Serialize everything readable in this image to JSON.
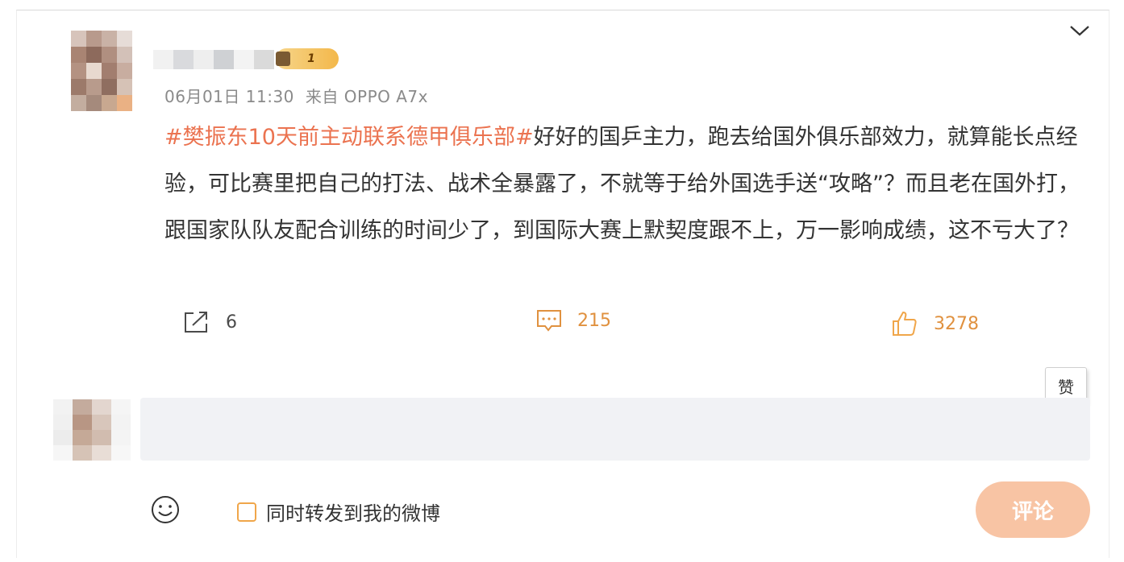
{
  "comment": {
    "badge_level": "1",
    "time": "06月01日 11:30",
    "source": "来自 OPPO A7x",
    "hashtag": "#樊振东10天前主动联系德甲俱乐部#",
    "text": "好好的国乒主力，跑去给国外俱乐部效力，就算能长点经验，可比赛里把自己的打法、战术全暴露了，不就等于给外国选手送“攻略”？而且老在国外打，跟国家队队友配合训练的时间少了，到国际大赛上默契度跟不上，万一影响成绩，这不亏大了？"
  },
  "actions": {
    "repost_count": "6",
    "comment_count": "215",
    "like_count": "3278"
  },
  "tooltip": {
    "like_tip": "赞"
  },
  "reply": {
    "placeholder": "",
    "repost_label": "同时转发到我的微博",
    "submit_label": "评论"
  },
  "icons": [
    "chevron-down-icon",
    "repost-icon",
    "comment-icon",
    "thumb-up-icon",
    "emoji-icon"
  ],
  "colors": {
    "hashtag": "#eb7350",
    "like_active": "#f0a64a",
    "submit_button": "#f8c4a4",
    "input_bg": "#f1f2f5"
  }
}
